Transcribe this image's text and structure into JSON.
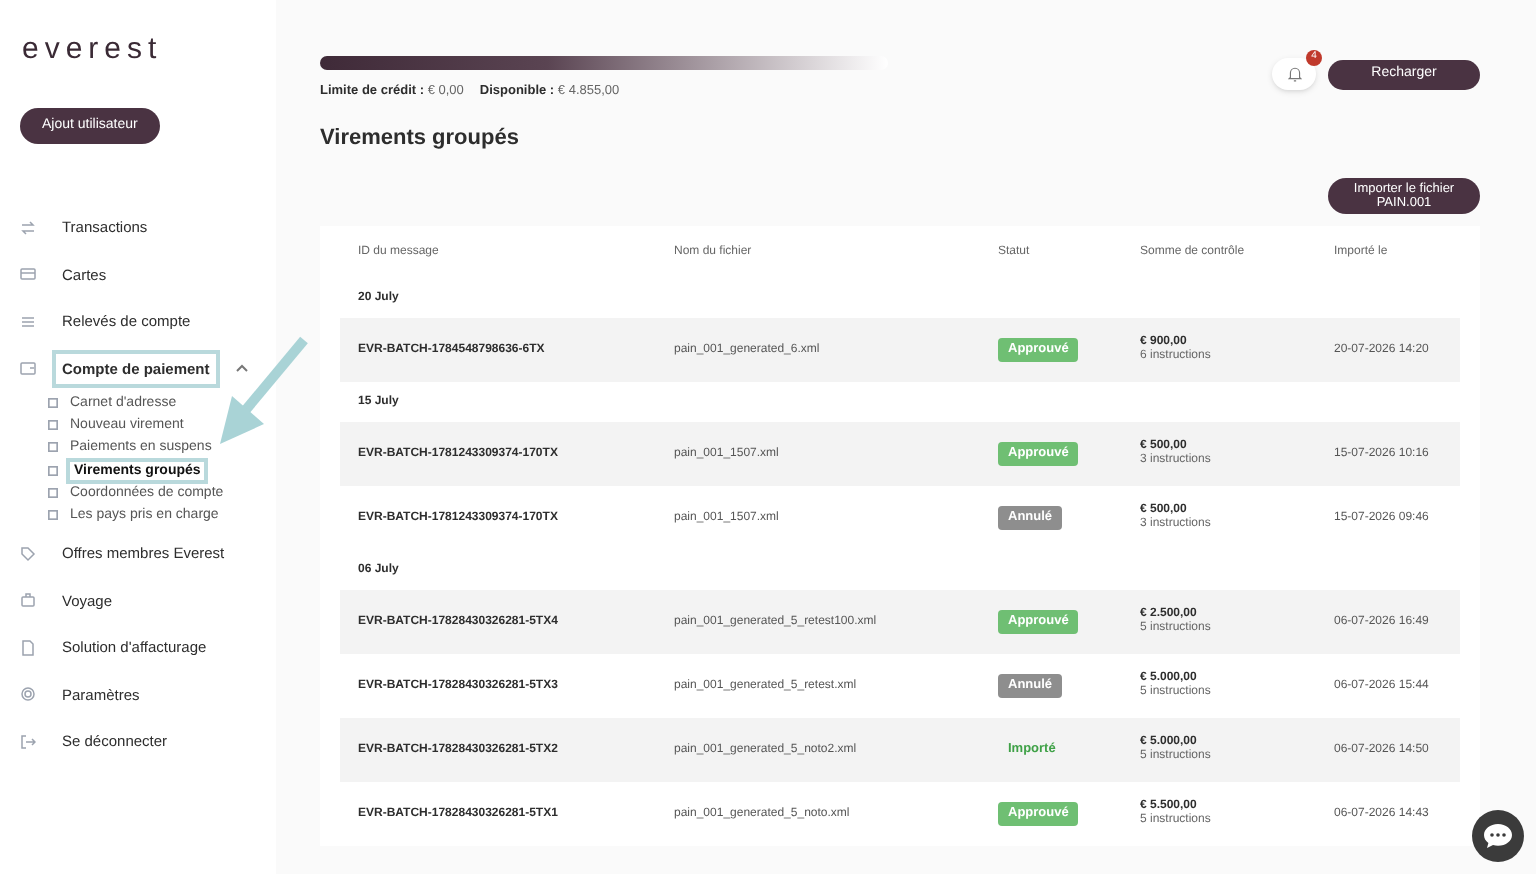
{
  "logo": "everest",
  "add_user_button": "Ajout utilisateur",
  "sidebar": {
    "items": [
      {
        "label": "Transactions",
        "kind": "arrows",
        "highlighted": false
      },
      {
        "label": "Cartes",
        "kind": "card",
        "highlighted": false
      },
      {
        "label": "Relevés de compte",
        "kind": "list",
        "highlighted": false
      },
      {
        "label": "Compte de paiement",
        "kind": "wallet",
        "highlighted": true,
        "expanded": true,
        "children": [
          {
            "label": "Carnet d'adresse",
            "selected": false,
            "highlighted": false
          },
          {
            "label": "Nouveau virement",
            "selected": false,
            "highlighted": false
          },
          {
            "label": "Paiements en suspens",
            "selected": false,
            "highlighted": false
          },
          {
            "label": "Virements groupés",
            "selected": true,
            "highlighted": true
          },
          {
            "label": "Coordonnées de compte",
            "selected": false,
            "highlighted": false
          },
          {
            "label": "Les pays pris en charge",
            "selected": false,
            "highlighted": false
          }
        ]
      },
      {
        "label": "Offres membres Everest",
        "kind": "tag",
        "highlighted": false
      },
      {
        "label": "Voyage",
        "kind": "bag",
        "highlighted": false
      },
      {
        "label": "Solution d'affacturage",
        "kind": "doc",
        "highlighted": false
      },
      {
        "label": "Paramètres",
        "kind": "gear",
        "highlighted": false
      },
      {
        "label": "Se déconnecter",
        "kind": "logout",
        "highlighted": false
      }
    ]
  },
  "credit": {
    "limit_label": "Limite de crédit :",
    "limit_value": "€ 0,00",
    "available_label": "Disponible :",
    "available_value": "€ 4.855,00"
  },
  "notifications": {
    "count": "4"
  },
  "recharge_button": "Recharger",
  "page_title": "Virements groupés",
  "import_button": "Importer le fichier PAIN.001",
  "table": {
    "columns": [
      "ID du message",
      "Nom du fichier",
      "Statut",
      "Somme de contrôle",
      "Importé le"
    ],
    "groups": [
      {
        "date": "20 July",
        "rows": [
          {
            "id": "EVR-BATCH-1784548798636-6TX",
            "file": "pain_001_generated_6.xml",
            "status": "Approuvé",
            "kind": "approved",
            "amount": "€ 900,00",
            "instructions": "6 instructions",
            "imported": "20-07-2026 14:20"
          }
        ]
      },
      {
        "date": "15 July",
        "rows": [
          {
            "id": "EVR-BATCH-1781243309374-170TX",
            "file": "pain_001_1507.xml",
            "status": "Approuvé",
            "kind": "approved",
            "amount": "€ 500,00",
            "instructions": "3 instructions",
            "imported": "15-07-2026 10:16"
          },
          {
            "id": "EVR-BATCH-1781243309374-170TX",
            "file": "pain_001_1507.xml",
            "status": "Annulé",
            "kind": "cancelled",
            "amount": "€ 500,00",
            "instructions": "3 instructions",
            "imported": "15-07-2026 09:46"
          }
        ]
      },
      {
        "date": "06 July",
        "rows": [
          {
            "id": "EVR-BATCH-17828430326281-5TX4",
            "file": "pain_001_generated_5_retest100.xml",
            "status": "Approuvé",
            "kind": "approved",
            "amount": "€ 2.500,00",
            "instructions": "5 instructions",
            "imported": "06-07-2026 16:49"
          },
          {
            "id": "EVR-BATCH-17828430326281-5TX3",
            "file": "pain_001_generated_5_retest.xml",
            "status": "Annulé",
            "kind": "cancelled",
            "amount": "€ 5.000,00",
            "instructions": "5 instructions",
            "imported": "06-07-2026 15:44"
          },
          {
            "id": "EVR-BATCH-17828430326281-5TX2",
            "file": "pain_001_generated_5_noto2.xml",
            "status": "Importé",
            "kind": "imported",
            "amount": "€ 5.000,00",
            "instructions": "5 instructions",
            "imported": "06-07-2026 14:50"
          },
          {
            "id": "EVR-BATCH-17828430326281-5TX1",
            "file": "pain_001_generated_5_noto.xml",
            "status": "Approuvé",
            "kind": "approved",
            "amount": "€ 5.500,00",
            "instructions": "5 instructions",
            "imported": "06-07-2026 14:43"
          }
        ]
      }
    ]
  }
}
